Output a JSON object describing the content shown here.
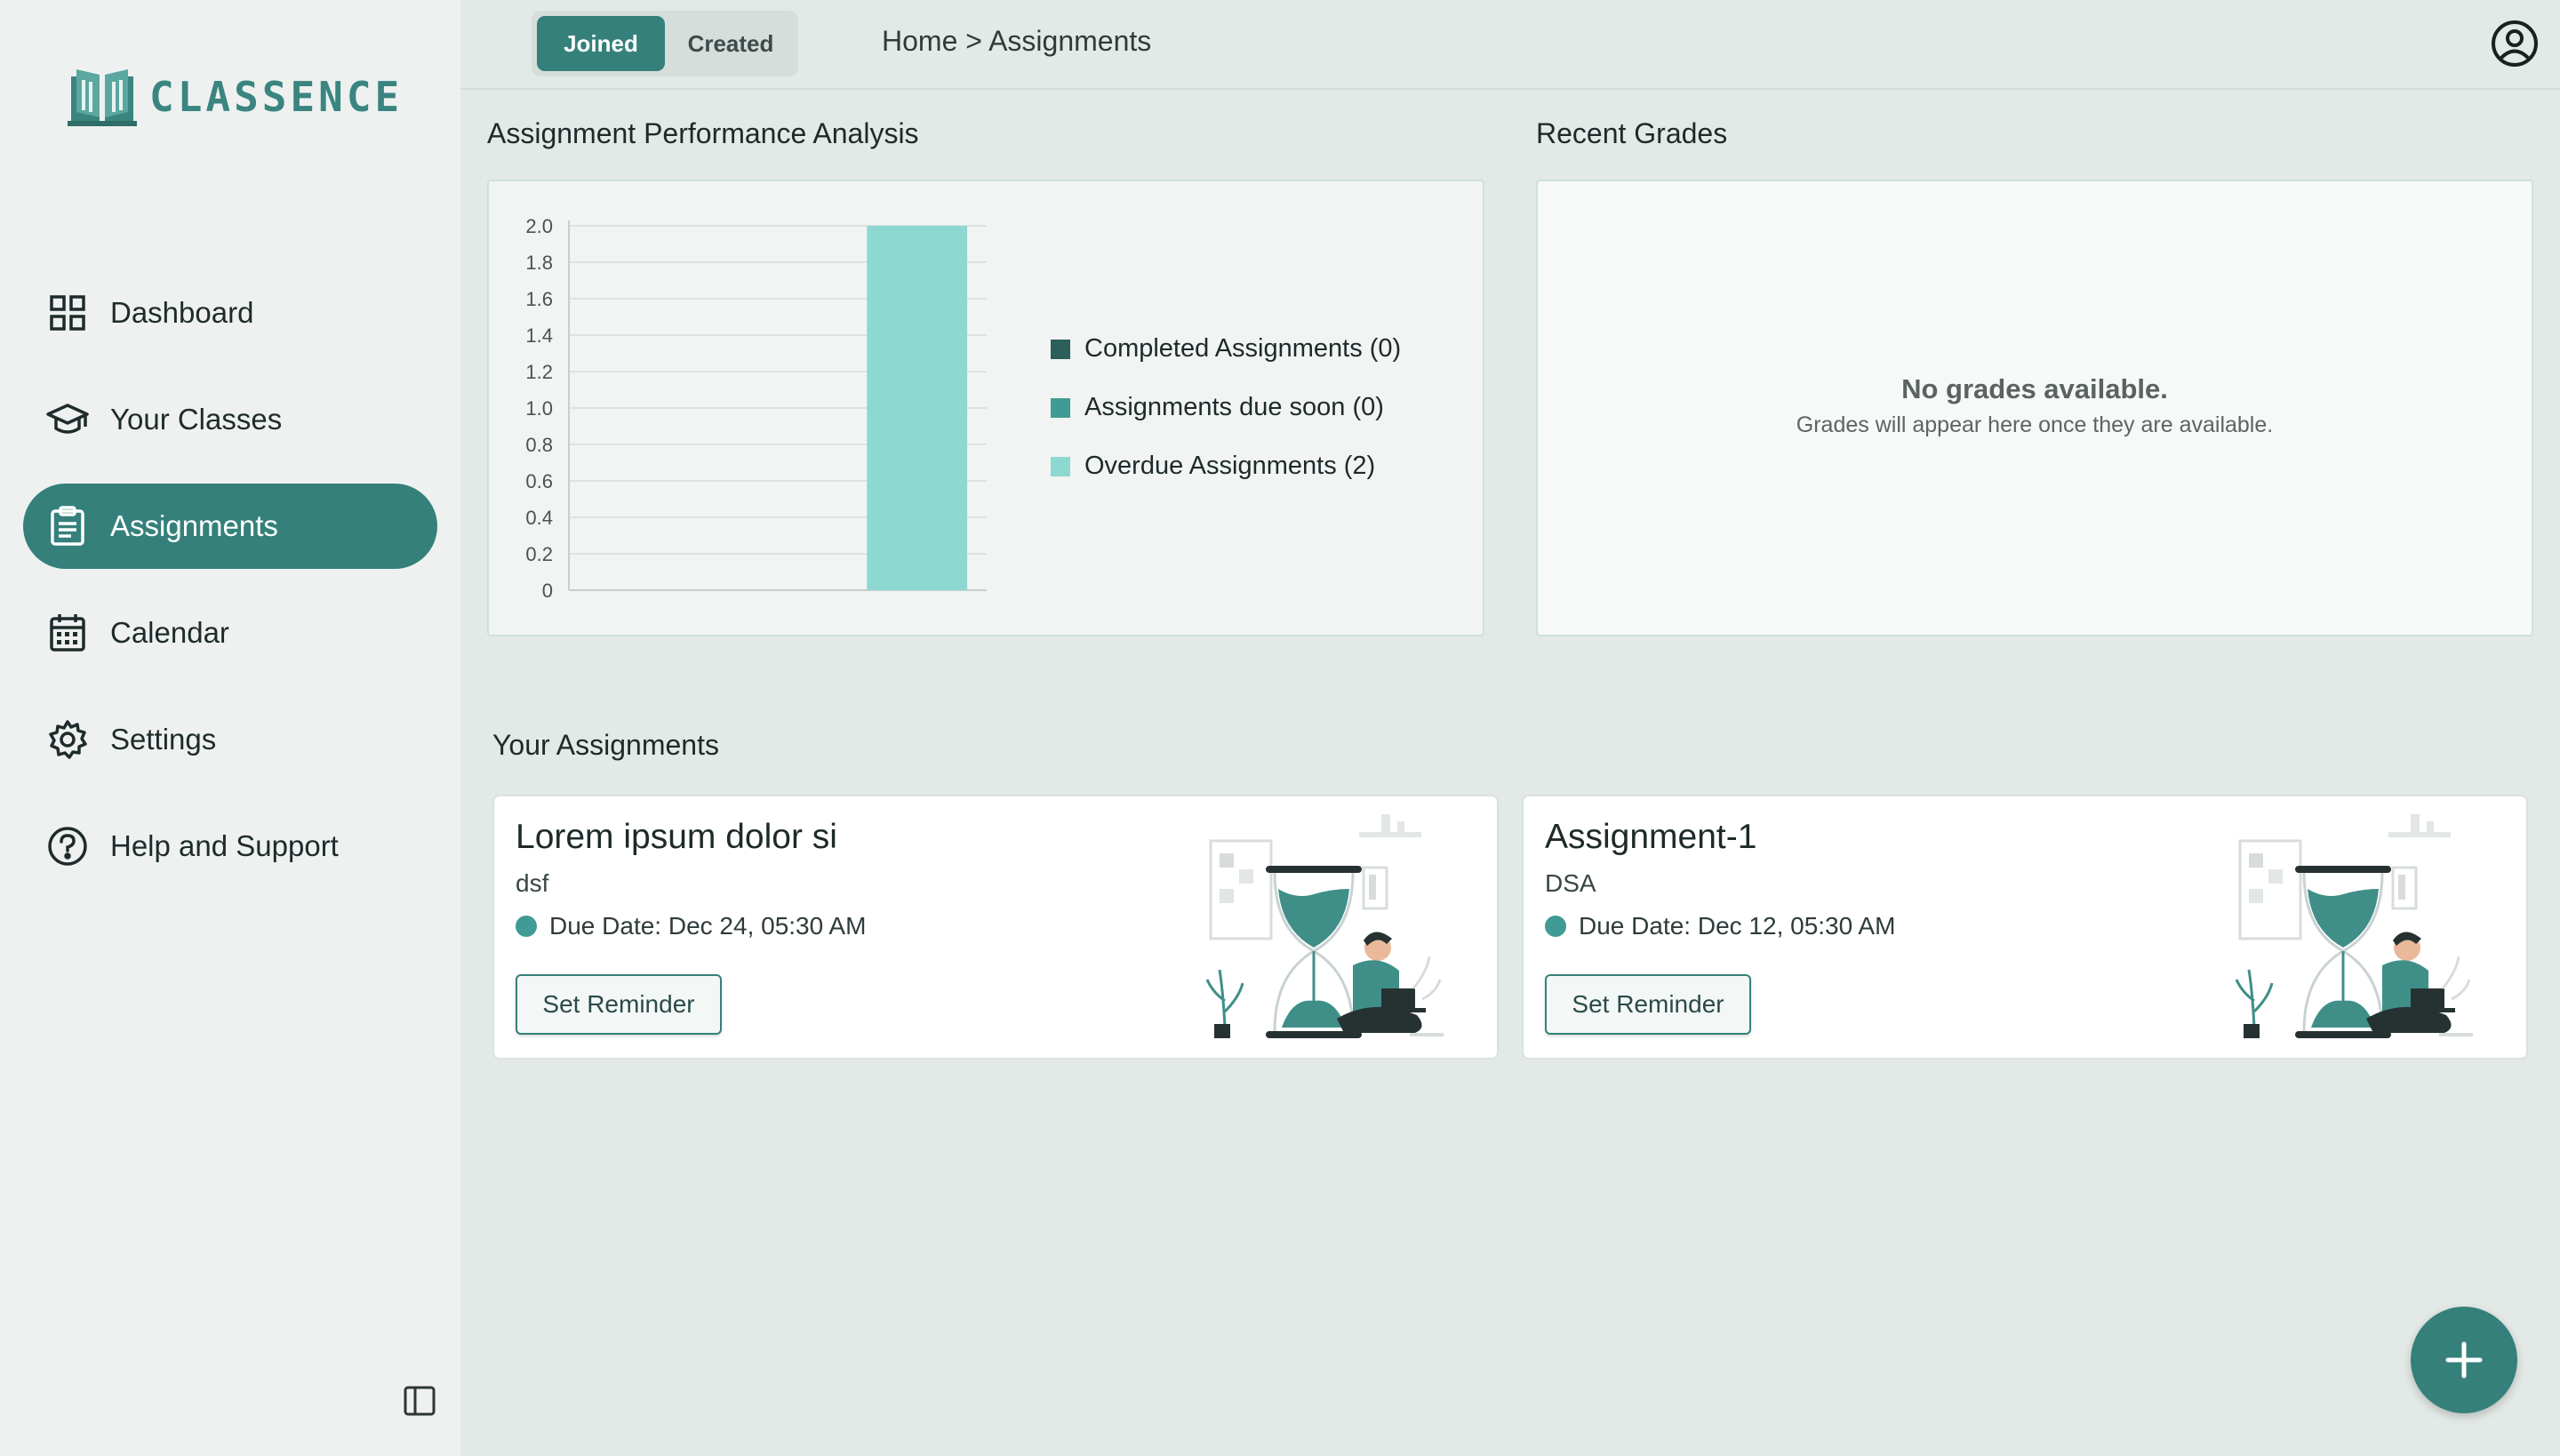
{
  "brand": {
    "name": "CLASSENCE"
  },
  "sidebar": {
    "items": [
      {
        "label": "Dashboard",
        "icon": "dashboard-icon"
      },
      {
        "label": "Your Classes",
        "icon": "graduation-cap-icon"
      },
      {
        "label": "Assignments",
        "icon": "clipboard-icon",
        "active": true
      },
      {
        "label": "Calendar",
        "icon": "calendar-icon"
      },
      {
        "label": "Settings",
        "icon": "gear-icon"
      },
      {
        "label": "Help and Support",
        "icon": "help-icon"
      }
    ]
  },
  "header": {
    "toggle": {
      "joined": "Joined",
      "created": "Created",
      "selected": "Joined"
    },
    "breadcrumb": "Home > Assignments"
  },
  "performance": {
    "title": "Assignment Performance Analysis",
    "chart_data": {
      "type": "bar",
      "categories": [
        "Completed Assignments",
        "Assignments due soon",
        "Overdue Assignments"
      ],
      "series": [
        {
          "name": "Completed Assignments (0)",
          "values": [
            0,
            0,
            0
          ],
          "color": "#2c5f5b"
        },
        {
          "name": "Assignments due soon (0)",
          "values": [
            0,
            0,
            0
          ],
          "color": "#3f9b93"
        },
        {
          "name": "Overdue Assignments (2)",
          "values": [
            0,
            0,
            2
          ],
          "color": "#8dd9d1"
        }
      ],
      "values": [
        0,
        0,
        2
      ],
      "ylim": [
        0,
        2
      ],
      "yticks": [
        "0",
        "0.2",
        "0.4",
        "0.6",
        "0.8",
        "1.0",
        "1.2",
        "1.4",
        "1.6",
        "1.8",
        "2.0"
      ],
      "grid": true,
      "legend": "right"
    }
  },
  "grades": {
    "title": "Recent Grades",
    "empty_title": "No grades available.",
    "empty_sub": "Grades will appear here once they are available."
  },
  "assignments": {
    "title": "Your Assignments",
    "items": [
      {
        "title": "Lorem ipsum dolor si",
        "subject": "dsf",
        "due": "Due Date: Dec 24, 05:30 AM",
        "button": "Set Reminder"
      },
      {
        "title": "Assignment-1",
        "subject": "DSA",
        "due": "Due Date: Dec 12, 05:30 AM",
        "button": "Set Reminder"
      }
    ]
  },
  "colors": {
    "accent": "#35807b",
    "bar": "#8dd9d1",
    "background": "#e3e9e6"
  }
}
